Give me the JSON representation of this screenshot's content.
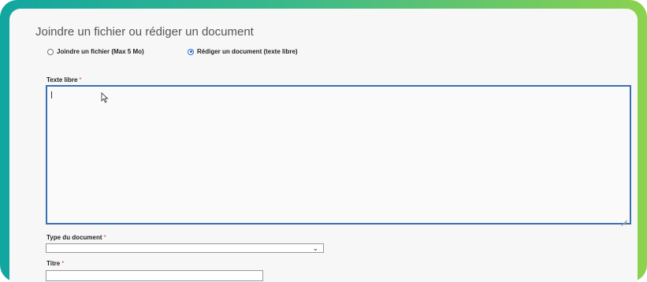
{
  "section": {
    "title": "Joindre un fichier ou rédiger un document"
  },
  "mode_options": [
    {
      "label": "Joindre un fichier (Max 5 Mo)",
      "selected": false
    },
    {
      "label": "Rédiger un document (texte libre)",
      "selected": true
    }
  ],
  "texte_libre": {
    "label": "Texte libre",
    "required_mark": "*",
    "value": ""
  },
  "type_document": {
    "label": "Type du document",
    "required_mark": "*",
    "selected_value": ""
  },
  "titre": {
    "label": "Titre",
    "required_mark": "*",
    "value": ""
  },
  "colors": {
    "accent": "#3a6fb0",
    "frame_start": "#12a6a0",
    "frame_end": "#8bd24f",
    "required": "#d9534f"
  }
}
